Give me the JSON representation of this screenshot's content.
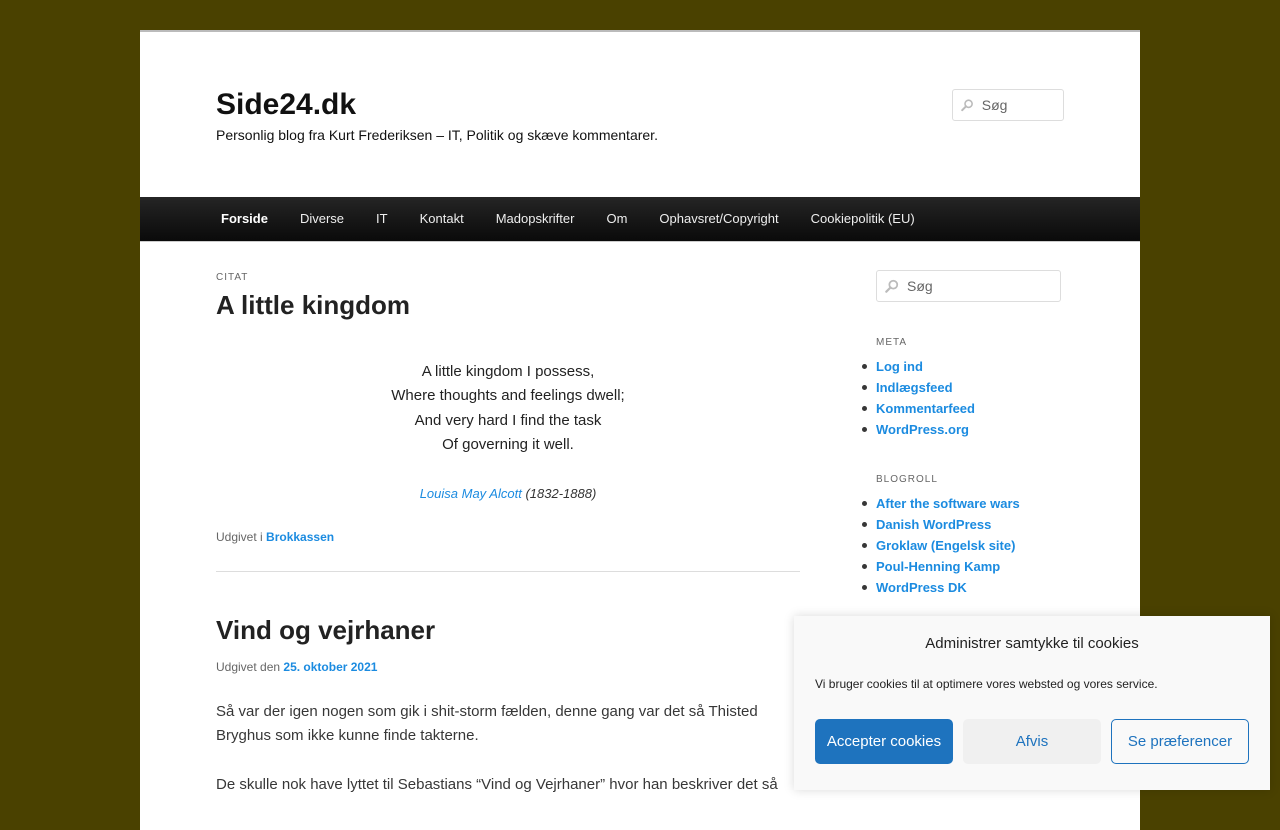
{
  "site": {
    "title": "Side24.dk",
    "description": "Personlig blog fra Kurt Frederiksen – IT, Politik og skæve kommentarer."
  },
  "search": {
    "placeholder": "Søg"
  },
  "nav": {
    "items": [
      "Forside",
      "Diverse",
      "IT",
      "Kontakt",
      "Madopskrifter",
      "Om",
      "Ophavsret/Copyright",
      "Cookiepolitik (EU)"
    ]
  },
  "post1": {
    "format": "Citat",
    "title": "A little kingdom",
    "quote": [
      "A little kingdom I possess,",
      "Where thoughts and feelings dwell;",
      "And very hard I find the task",
      "Of governing it well."
    ],
    "author": "Louisa May Alcott",
    "years": " (1832-1888)",
    "meta_prefix": "Udgivet i ",
    "category": "Brokkassen"
  },
  "post2": {
    "title": "Vind og vejrhaner",
    "meta_prefix": "Udgivet den ",
    "date": "25. oktober 2021",
    "p1": "Så var der igen nogen som gik i shit-storm fælden, denne gang var det så Thisted Bryghus som ikke kunne finde takterne.",
    "p2": "De skulle nok have lyttet til Sebastians “Vind og Vejrhaner” hvor han beskriver det så"
  },
  "sidebar": {
    "meta_title": "Meta",
    "meta_links": [
      "Log ind",
      "Indlægsfeed",
      "Kommentarfeed",
      "WordPress.org"
    ],
    "blogroll_title": "Blogroll",
    "blogroll_links": [
      "After the software wars",
      "Danish WordPress",
      "Groklaw (Engelsk site)",
      "Poul-Henning Kamp",
      "WordPress DK"
    ]
  },
  "cookie": {
    "title": "Administrer samtykke til cookies",
    "text": "Vi bruger cookies til at optimere vores websted og vores service.",
    "accept": "Accepter cookies",
    "deny": "Afvis",
    "preferences": "Se præferencer"
  },
  "colors": {
    "background": "#4a4100",
    "link": "#1b8be0",
    "accept_button": "#1e73be",
    "nav_bar": "#1a1a1a"
  }
}
